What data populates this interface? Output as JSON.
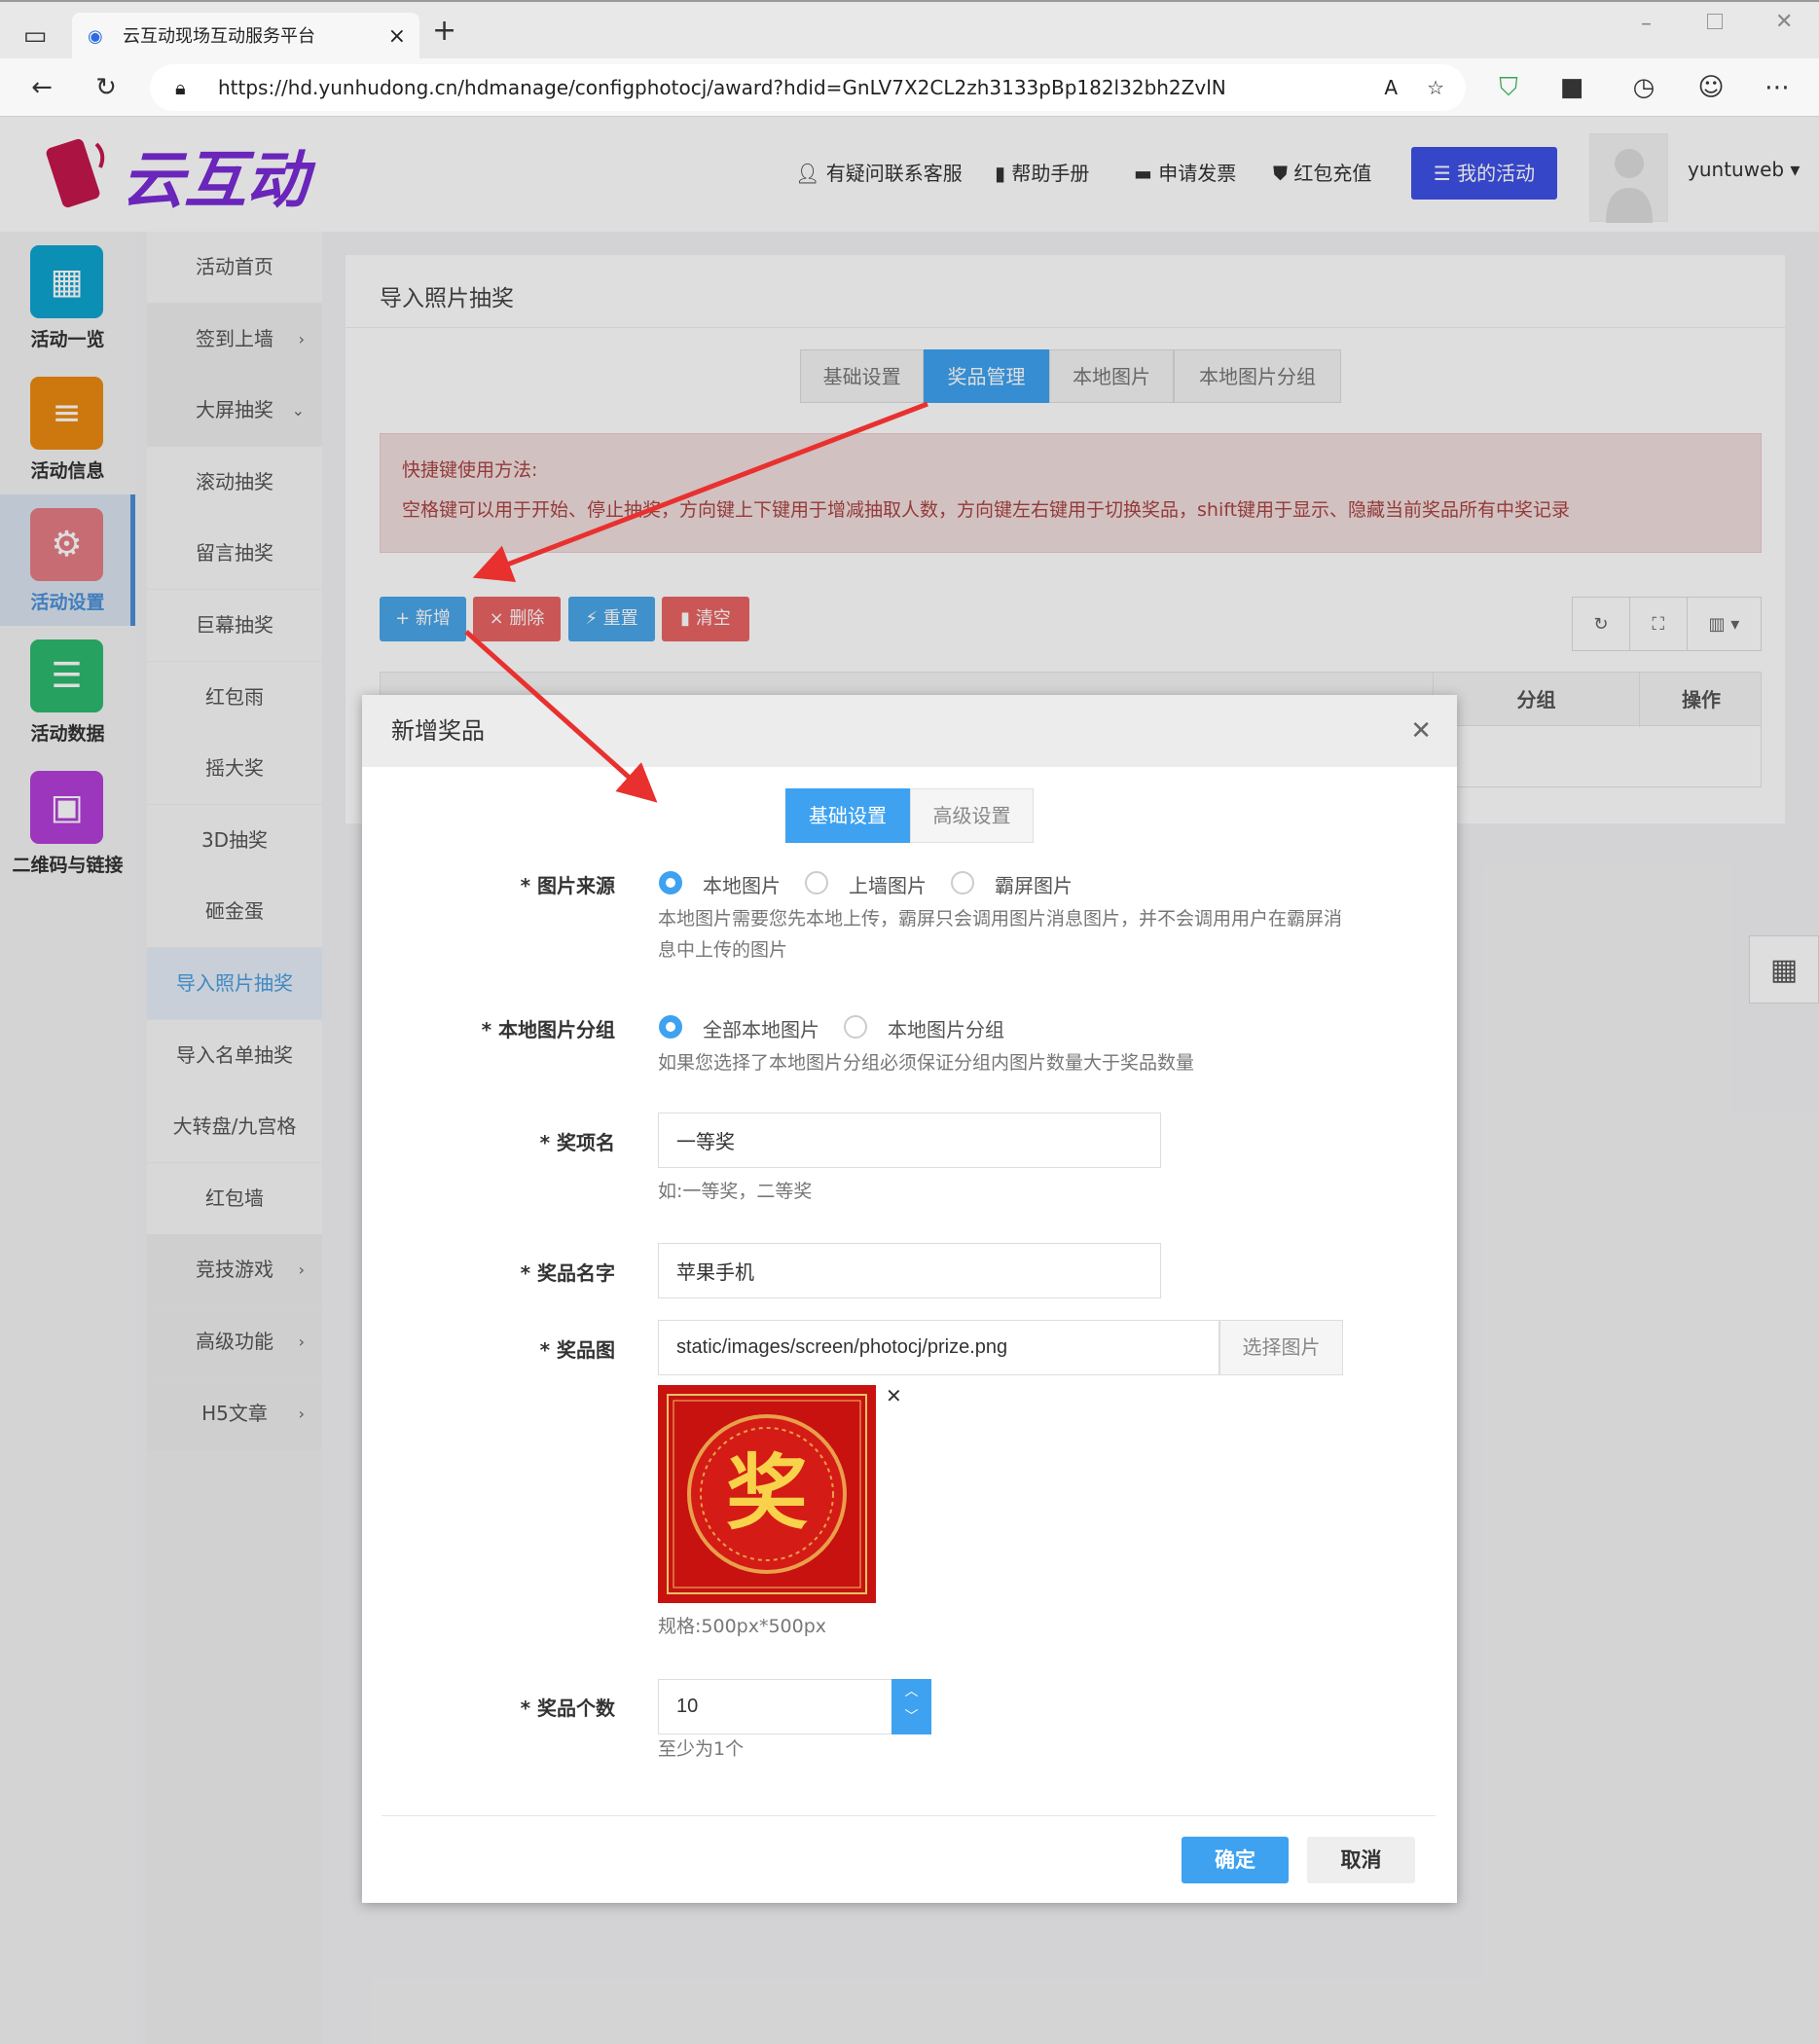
{
  "browser": {
    "tab_title": "云互动现场互动服务平台",
    "url": "https://hd.yunhudong.cn/hdmanage/configphotocj/award?hdid=GnLV7X2CL2zh3133pBp182l32bh2ZvlN",
    "new_tab": "+",
    "close_tab": "×"
  },
  "header": {
    "logo": "云互动",
    "links": [
      "有疑问联系客服",
      "帮助手册",
      "申请发票",
      "红包充值"
    ],
    "my_activity": "我的活动",
    "username": "yuntuweb"
  },
  "iconbar": [
    {
      "label": "活动一览",
      "color": "#0ea5d0"
    },
    {
      "label": "活动信息",
      "color": "#ec8a11"
    },
    {
      "label": "活动设置",
      "color": "#e67c85",
      "active": true
    },
    {
      "label": "活动数据",
      "color": "#2cb96e"
    },
    {
      "label": "二维码与链接",
      "color": "#b43ed9"
    }
  ],
  "menu": [
    {
      "label": "活动首页"
    },
    {
      "label": "签到上墙",
      "chev": "›",
      "dark": true
    },
    {
      "label": "大屏抽奖",
      "chev": "⌄",
      "dark": true
    },
    {
      "label": "滚动抽奖"
    },
    {
      "label": "留言抽奖"
    },
    {
      "label": "巨幕抽奖"
    },
    {
      "label": "红包雨"
    },
    {
      "label": "摇大奖"
    },
    {
      "label": "3D抽奖"
    },
    {
      "label": "砸金蛋"
    },
    {
      "label": "导入照片抽奖",
      "active": true
    },
    {
      "label": "导入名单抽奖"
    },
    {
      "label": "大转盘/九宫格"
    },
    {
      "label": "红包墙"
    },
    {
      "label": "竞技游戏",
      "chev": "›",
      "dark": true
    },
    {
      "label": "高级功能",
      "chev": "›",
      "dark": true
    },
    {
      "label": "H5文章",
      "chev": "›",
      "dark": true
    }
  ],
  "panel": {
    "title": "导入照片抽奖",
    "tabs": [
      "基础设置",
      "奖品管理",
      "本地图片",
      "本地图片分组"
    ],
    "active_tab": 1,
    "alert_title": "快捷键使用方法:",
    "alert_text": "空格键可以用于开始、停止抽奖，方向键上下键用于增减抽取人数，方向键左右键用于切换奖品，shift键用于显示、隐藏当前奖品所有中奖记录",
    "buttons": [
      "+ 新增",
      "× 删除",
      "重置",
      "清空"
    ],
    "table_headers": [
      "分组",
      "操作"
    ]
  },
  "modal": {
    "title": "新增奖品",
    "tabs": [
      "基础设置",
      "高级设置"
    ],
    "source_label": "* 图片来源",
    "source_options": [
      "本地图片",
      "上墙图片",
      "霸屏图片"
    ],
    "source_help": "本地图片需要您先本地上传，霸屏只会调用图片消息图片，并不会调用用户在霸屏消息中上传的图片",
    "group_label": "* 本地图片分组",
    "group_options": [
      "全部本地图片",
      "本地图片分组"
    ],
    "group_help": "如果您选择了本地图片分组必须保证分组内图片数量大于奖品数量",
    "award_label": "* 奖项名",
    "award_value": "一等奖",
    "award_help": "如:一等奖，二等奖",
    "prize_label": "* 奖品名字",
    "prize_value": "苹果手机",
    "image_label": "* 奖品图",
    "image_value": "static/images/screen/photocj/prize.png",
    "image_button": "选择图片",
    "image_glyph": "奖",
    "image_spec": "规格:500px*500px",
    "count_label": "* 奖品个数",
    "count_value": "10",
    "count_help": "至少为1个",
    "ok": "确定",
    "cancel": "取消"
  },
  "colors": {
    "primary": "#3ea2f0",
    "danger": "#d9534f",
    "brand_button": "#3f51e6",
    "arrow": "#e8312f"
  }
}
